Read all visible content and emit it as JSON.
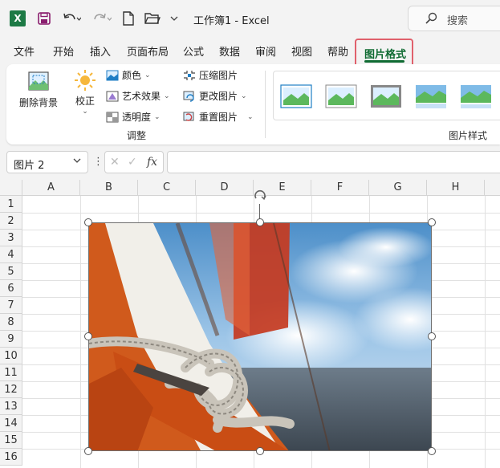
{
  "titlebar": {
    "app_title": "工作簿1  -  Excel",
    "search_label": "搜索"
  },
  "tabs": [
    {
      "label": "文件"
    },
    {
      "label": "开始"
    },
    {
      "label": "插入"
    },
    {
      "label": "页面布局"
    },
    {
      "label": "公式"
    },
    {
      "label": "数据"
    },
    {
      "label": "审阅"
    },
    {
      "label": "视图"
    },
    {
      "label": "帮助"
    }
  ],
  "active_tab": "图片格式",
  "ribbon": {
    "remove_bg": "删除背景",
    "corrections": "校正",
    "color": "颜色",
    "artistic": "艺术效果",
    "transparency": "透明度",
    "compress": "压缩图片",
    "change": "更改图片",
    "reset": "重置图片",
    "group_adjust": "调整",
    "group_styles": "图片样式"
  },
  "formula_bar": {
    "name_box": "图片 2",
    "fx": "fx"
  },
  "columns": [
    "A",
    "B",
    "C",
    "D",
    "E",
    "F",
    "G",
    "H"
  ],
  "rows": [
    "1",
    "2",
    "3",
    "4",
    "5",
    "6",
    "7",
    "8",
    "9",
    "10",
    "11",
    "12",
    "13",
    "14",
    "15",
    "16"
  ],
  "colors": {
    "accent": "#0f6b32",
    "highlight_border": "#e0606c",
    "excel_green": "#1d7a45"
  }
}
